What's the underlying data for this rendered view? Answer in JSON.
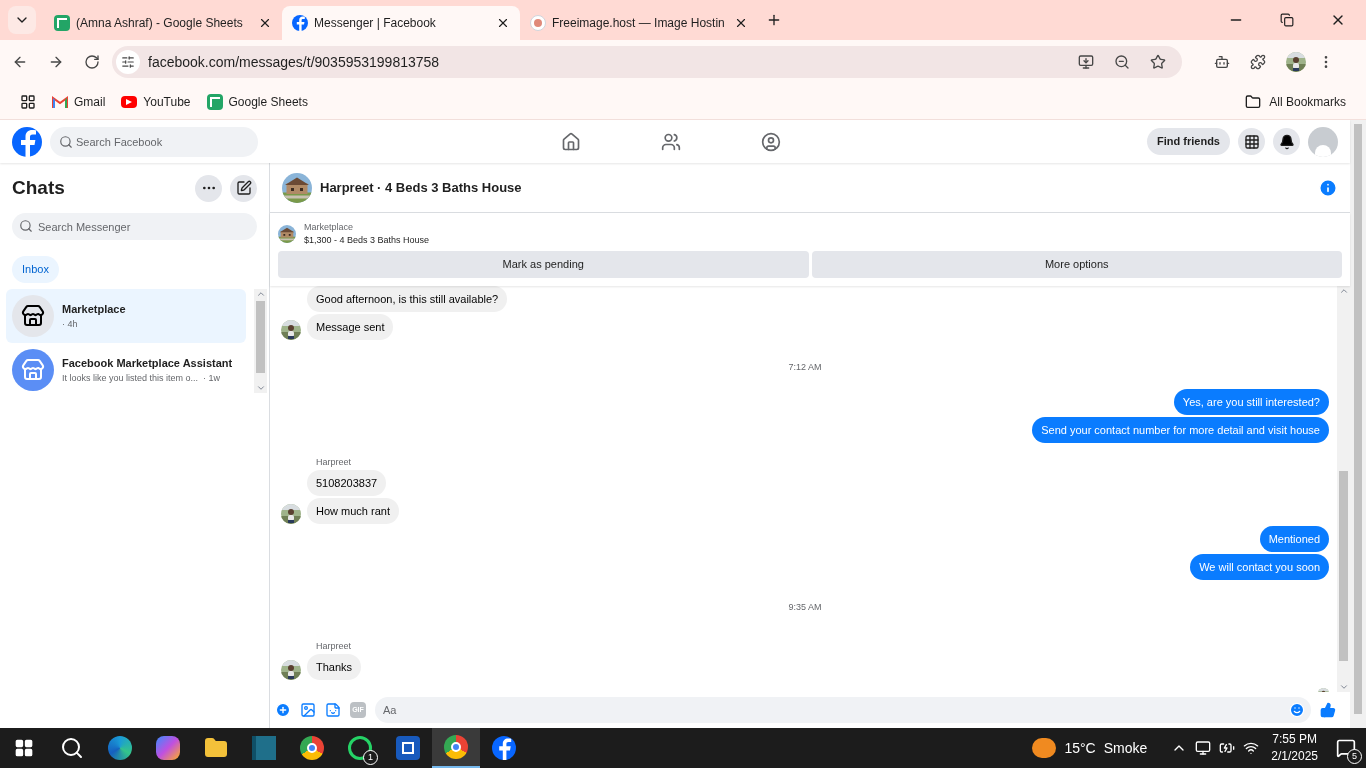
{
  "browser": {
    "tabs": [
      {
        "title": "(Amna Ashraf) - Google Sheets",
        "selected": false
      },
      {
        "title": "Messenger | Facebook",
        "selected": true
      },
      {
        "title": "Freeimage.host — Image Hostin",
        "selected": false
      }
    ],
    "url": "facebook.com/messages/t/9035953199813758",
    "bookmarks": [
      "Gmail",
      "YouTube",
      "Google Sheets"
    ],
    "all_bookmarks": "All Bookmarks"
  },
  "facebook": {
    "search": {
      "placeholder": "Search Facebook"
    },
    "find_friends": "Find friends"
  },
  "sidebar": {
    "title": "Chats",
    "search": {
      "placeholder": "Search Messenger"
    },
    "filter": "Inbox",
    "chats": [
      {
        "name": "Marketplace",
        "preview": "· 4h",
        "selected": true
      },
      {
        "name": "Facebook Marketplace Assistant",
        "preview": "It looks like you listed this item o...  · 1w",
        "selected": false
      }
    ]
  },
  "conversation": {
    "title": "Harpreet · 4 Beds 3 Baths House",
    "listing": {
      "source": "Marketplace",
      "title": "$1,300 - 4 Beds 3 Baths House",
      "actions": [
        "Mark as pending",
        "More options"
      ]
    },
    "messages": [
      {
        "kind": "incoming",
        "text": "Good afternoon, is this still available?",
        "avatar": false
      },
      {
        "kind": "incoming",
        "text": "Message sent",
        "avatar": true
      },
      {
        "kind": "time",
        "text": "7:12 AM"
      },
      {
        "kind": "outgoing",
        "text": "Yes, are you still interested?"
      },
      {
        "kind": "outgoing",
        "text": "Send your contact number for more detail and visit house"
      },
      {
        "kind": "sender",
        "text": "Harpreet"
      },
      {
        "kind": "incoming",
        "text": "5108203837",
        "avatar": false
      },
      {
        "kind": "incoming",
        "text": "How much rant",
        "avatar": true
      },
      {
        "kind": "outgoing",
        "text": "Mentioned"
      },
      {
        "kind": "outgoing",
        "text": "We will contact you soon"
      },
      {
        "kind": "time",
        "text": "9:35 AM"
      },
      {
        "kind": "sender",
        "text": "Harpreet"
      },
      {
        "kind": "incoming",
        "text": "Thanks",
        "avatar": true
      }
    ],
    "composer": {
      "placeholder": "Aa",
      "gif": "GIF"
    }
  },
  "taskbar": {
    "apps": [
      {
        "selected": false
      },
      {
        "selected": false
      },
      {
        "selected": false
      },
      {
        "selected": false
      },
      {
        "selected": false
      },
      {
        "selected": false,
        "badge": "1"
      },
      {
        "selected": false
      },
      {
        "selected": true
      },
      {
        "selected": false
      }
    ],
    "weather": {
      "temp": "15°C",
      "condition": "Smoke"
    },
    "time": "7:55 PM",
    "date": "2/1/2025",
    "notifications": "5"
  }
}
